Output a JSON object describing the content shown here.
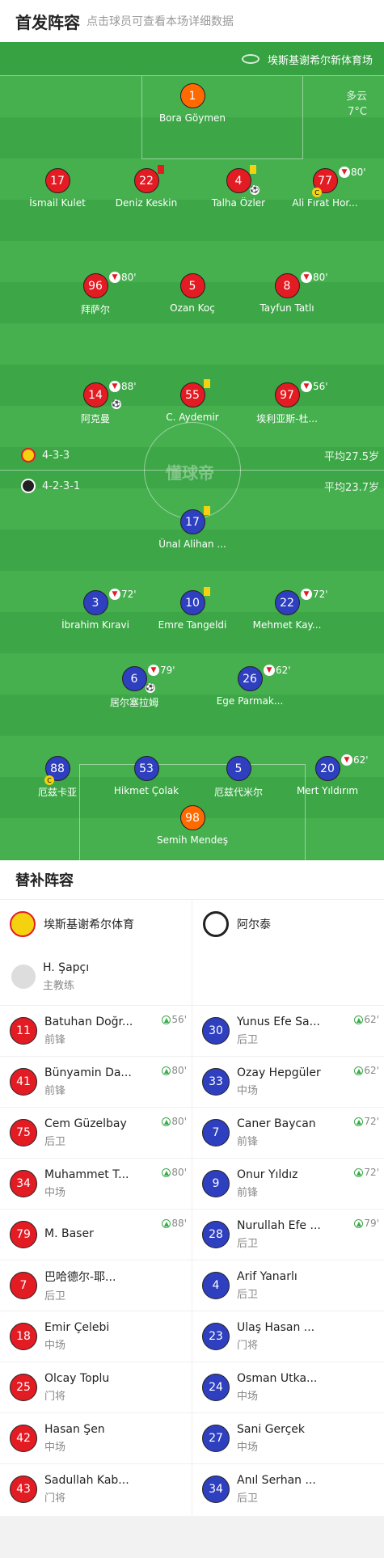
{
  "header": {
    "title": "首发阵容",
    "subtitle": "点击球员可查看本场详细数据"
  },
  "pitch": {
    "venue": "埃斯基谢希尔新体育场",
    "weather": "多云",
    "temp": "7°C",
    "brand": "懂球帝",
    "home_formation": "4-3-3",
    "home_avg": "平均27.5岁",
    "away_formation": "4-2-3-1",
    "away_avg": "平均23.7岁"
  },
  "players": [
    {
      "num": "1",
      "name": "Bora Göymen"
    },
    {
      "num": "17",
      "name": "İsmail Kulet"
    },
    {
      "num": "22",
      "name": "Deniz Keskin"
    },
    {
      "num": "4",
      "name": "Talha Özler"
    },
    {
      "num": "77",
      "name": "Ali Fırat Hor...",
      "sub": "80'"
    },
    {
      "num": "96",
      "name": "拜萨尔",
      "sub": "80'"
    },
    {
      "num": "5",
      "name": "Ozan Koç"
    },
    {
      "num": "8",
      "name": "Tayfun Tatlı",
      "sub": "80'"
    },
    {
      "num": "14",
      "name": "阿克曼",
      "sub": "88'"
    },
    {
      "num": "55",
      "name": "C. Aydemir"
    },
    {
      "num": "97",
      "name": "埃利亚斯-杜...",
      "sub": "56'"
    },
    {
      "num": "17",
      "name": "Ünal Alihan ..."
    },
    {
      "num": "3",
      "name": "İbrahim Kıravi",
      "sub": "72'"
    },
    {
      "num": "10",
      "name": "Emre Tangeldi"
    },
    {
      "num": "22",
      "name": "Mehmet Kay...",
      "sub": "72'"
    },
    {
      "num": "6",
      "name": "居尔塞拉姆",
      "sub": "79'"
    },
    {
      "num": "26",
      "name": "Ege Parmak...",
      "sub": "62'"
    },
    {
      "num": "88",
      "name": "厄兹卡亚"
    },
    {
      "num": "53",
      "name": "Hikmet Çolak"
    },
    {
      "num": "5",
      "name": "厄兹代米尔"
    },
    {
      "num": "20",
      "name": "Mert Yıldırım",
      "sub": "62'"
    },
    {
      "num": "98",
      "name": "Semih Mendeş"
    }
  ],
  "subs": {
    "title": "替补阵容",
    "home_team": "埃斯基谢希尔体育",
    "away_team": "阿尔泰",
    "coach_name": "H. Şapçı",
    "coach_role": "主教练",
    "home": [
      {
        "num": "11",
        "name": "Batuhan Doğr...",
        "pos": "前锋",
        "evt": "56'"
      },
      {
        "num": "41",
        "name": "Bünyamin Da...",
        "pos": "前锋",
        "evt": "80'"
      },
      {
        "num": "75",
        "name": "Cem Güzelbay",
        "pos": "后卫",
        "evt": "80'"
      },
      {
        "num": "34",
        "name": "Muhammet T...",
        "pos": "中场",
        "evt": "80'"
      },
      {
        "num": "79",
        "name": "M. Baser",
        "pos": "",
        "evt": "88'"
      },
      {
        "num": "7",
        "name": "巴哈德尔-耶...",
        "pos": "后卫",
        "evt": ""
      },
      {
        "num": "18",
        "name": "Emir Çelebi",
        "pos": "中场",
        "evt": ""
      },
      {
        "num": "25",
        "name": "Olcay Toplu",
        "pos": "门将",
        "evt": ""
      },
      {
        "num": "42",
        "name": "Hasan Şen",
        "pos": "中场",
        "evt": ""
      },
      {
        "num": "43",
        "name": "Sadullah Kab...",
        "pos": "门将",
        "evt": ""
      }
    ],
    "away": [
      {
        "num": "30",
        "name": "Yunus Efe Sa...",
        "pos": "后卫",
        "evt": "62'"
      },
      {
        "num": "33",
        "name": "Özay Hepgüler",
        "pos": "中场",
        "evt": "62'"
      },
      {
        "num": "7",
        "name": "Caner Baycan",
        "pos": "前锋",
        "evt": "72'"
      },
      {
        "num": "9",
        "name": "Onur Yıldız",
        "pos": "前锋",
        "evt": "72'"
      },
      {
        "num": "28",
        "name": "Nurullah Efe ...",
        "pos": "后卫",
        "evt": "79'"
      },
      {
        "num": "4",
        "name": "Arif Yanarlı",
        "pos": "后卫",
        "evt": ""
      },
      {
        "num": "23",
        "name": "Ulaş Hasan ...",
        "pos": "门将",
        "evt": ""
      },
      {
        "num": "24",
        "name": "Osman Utka...",
        "pos": "中场",
        "evt": ""
      },
      {
        "num": "27",
        "name": "Sani Gerçek",
        "pos": "中场",
        "evt": ""
      },
      {
        "num": "34",
        "name": "Anıl Serhan ...",
        "pos": "后卫",
        "evt": ""
      }
    ]
  }
}
